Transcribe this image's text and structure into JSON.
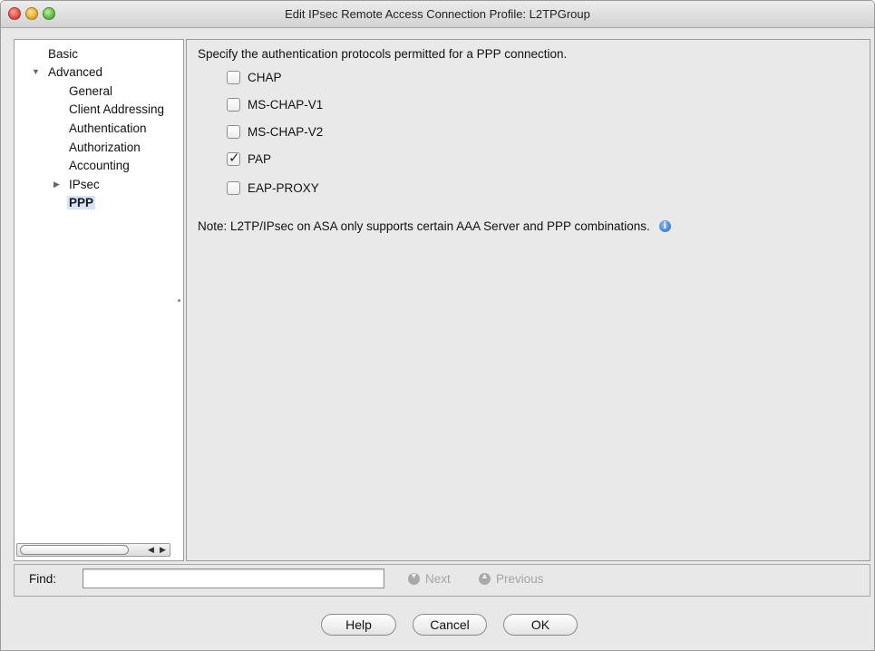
{
  "window": {
    "title": "Edit IPsec Remote Access Connection Profile: L2TPGroup"
  },
  "tree": {
    "items": [
      {
        "label": "Basic"
      },
      {
        "label": "Advanced",
        "expanded": true
      },
      {
        "label": "General"
      },
      {
        "label": "Client Addressinɡ"
      },
      {
        "label": "Authentication"
      },
      {
        "label": "Authorization"
      },
      {
        "label": "Accounting"
      },
      {
        "label": "IPsec",
        "expanded": false
      },
      {
        "label": "PPP",
        "selected": true
      }
    ]
  },
  "main": {
    "heading": "Specify the authentication protocols permitted for a PPP connection.",
    "options": [
      {
        "label": "CHAP",
        "checked": false
      },
      {
        "label": "MS-CHAP-V1",
        "checked": false
      },
      {
        "label": "MS-CHAP-V2",
        "checked": false
      },
      {
        "label": "PAP",
        "checked": true
      },
      {
        "label": "EAP-PROXY",
        "checked": false
      }
    ],
    "note": "Note: L2TP/IPsec on ASA only supports certain AAA Server and PPP combinations."
  },
  "find": {
    "label": "Find:",
    "value": "",
    "next_label": "Next",
    "previous_label": "Previous"
  },
  "buttons": {
    "help": "Help",
    "cancel": "Cancel",
    "ok": "OK"
  },
  "colors": {
    "selection": "#d6e4fa",
    "info_icon": "#3f7ee0",
    "disabled_text": "#a4a4a4"
  }
}
